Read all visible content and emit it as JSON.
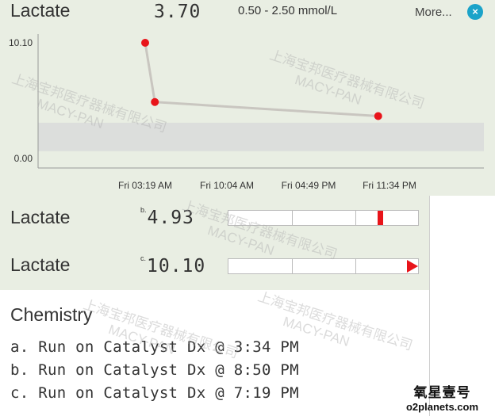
{
  "header": {
    "name": "Lactate",
    "value": "3.70",
    "range": "0.50 - 2.50 mmol/L",
    "more_label": "More...",
    "close_glyph": "×"
  },
  "chart_data": {
    "type": "line",
    "x": [
      "Fri 03:19 AM",
      "Fri 10:04 AM",
      "Fri 04:49 PM",
      "Fri 11:34 PM"
    ],
    "y_ticks": [
      "10.10",
      "0.00"
    ],
    "ylim": [
      0.0,
      10.1
    ],
    "reference_band": [
      0.5,
      2.5
    ],
    "series": [
      {
        "points": [
          {
            "time": "Fri 03:19 AM",
            "value": 10.1
          },
          {
            "time": "Fri 04:07 AM",
            "value": 4.93
          },
          {
            "time": "Fri 10:34 PM",
            "value": 3.7
          }
        ]
      }
    ],
    "grid": false,
    "colors": {
      "line": "#c9c6c0",
      "point": "#e8141a",
      "band": "#dcdedc"
    }
  },
  "results": [
    {
      "label": "Lactate",
      "ref": "b.",
      "value": "4.93",
      "marker_fraction": 0.78,
      "arrow": false
    },
    {
      "label": "Lactate",
      "ref": "c.",
      "value": "10.10",
      "marker_fraction": 1.0,
      "arrow": true
    }
  ],
  "chemistry": {
    "title": "Chemistry",
    "lines": [
      "a. Run on Catalyst Dx @ 3:34 PM",
      "b. Run on Catalyst Dx @ 8:50 PM",
      "c. Run on Catalyst Dx @ 7:19 PM"
    ]
  },
  "watermark": {
    "cn": "上海宝邦医疗器械有限公司",
    "en": "MACY-PAN"
  },
  "logo": {
    "cn": "氧星壹号",
    "en": "o2planets.com"
  }
}
